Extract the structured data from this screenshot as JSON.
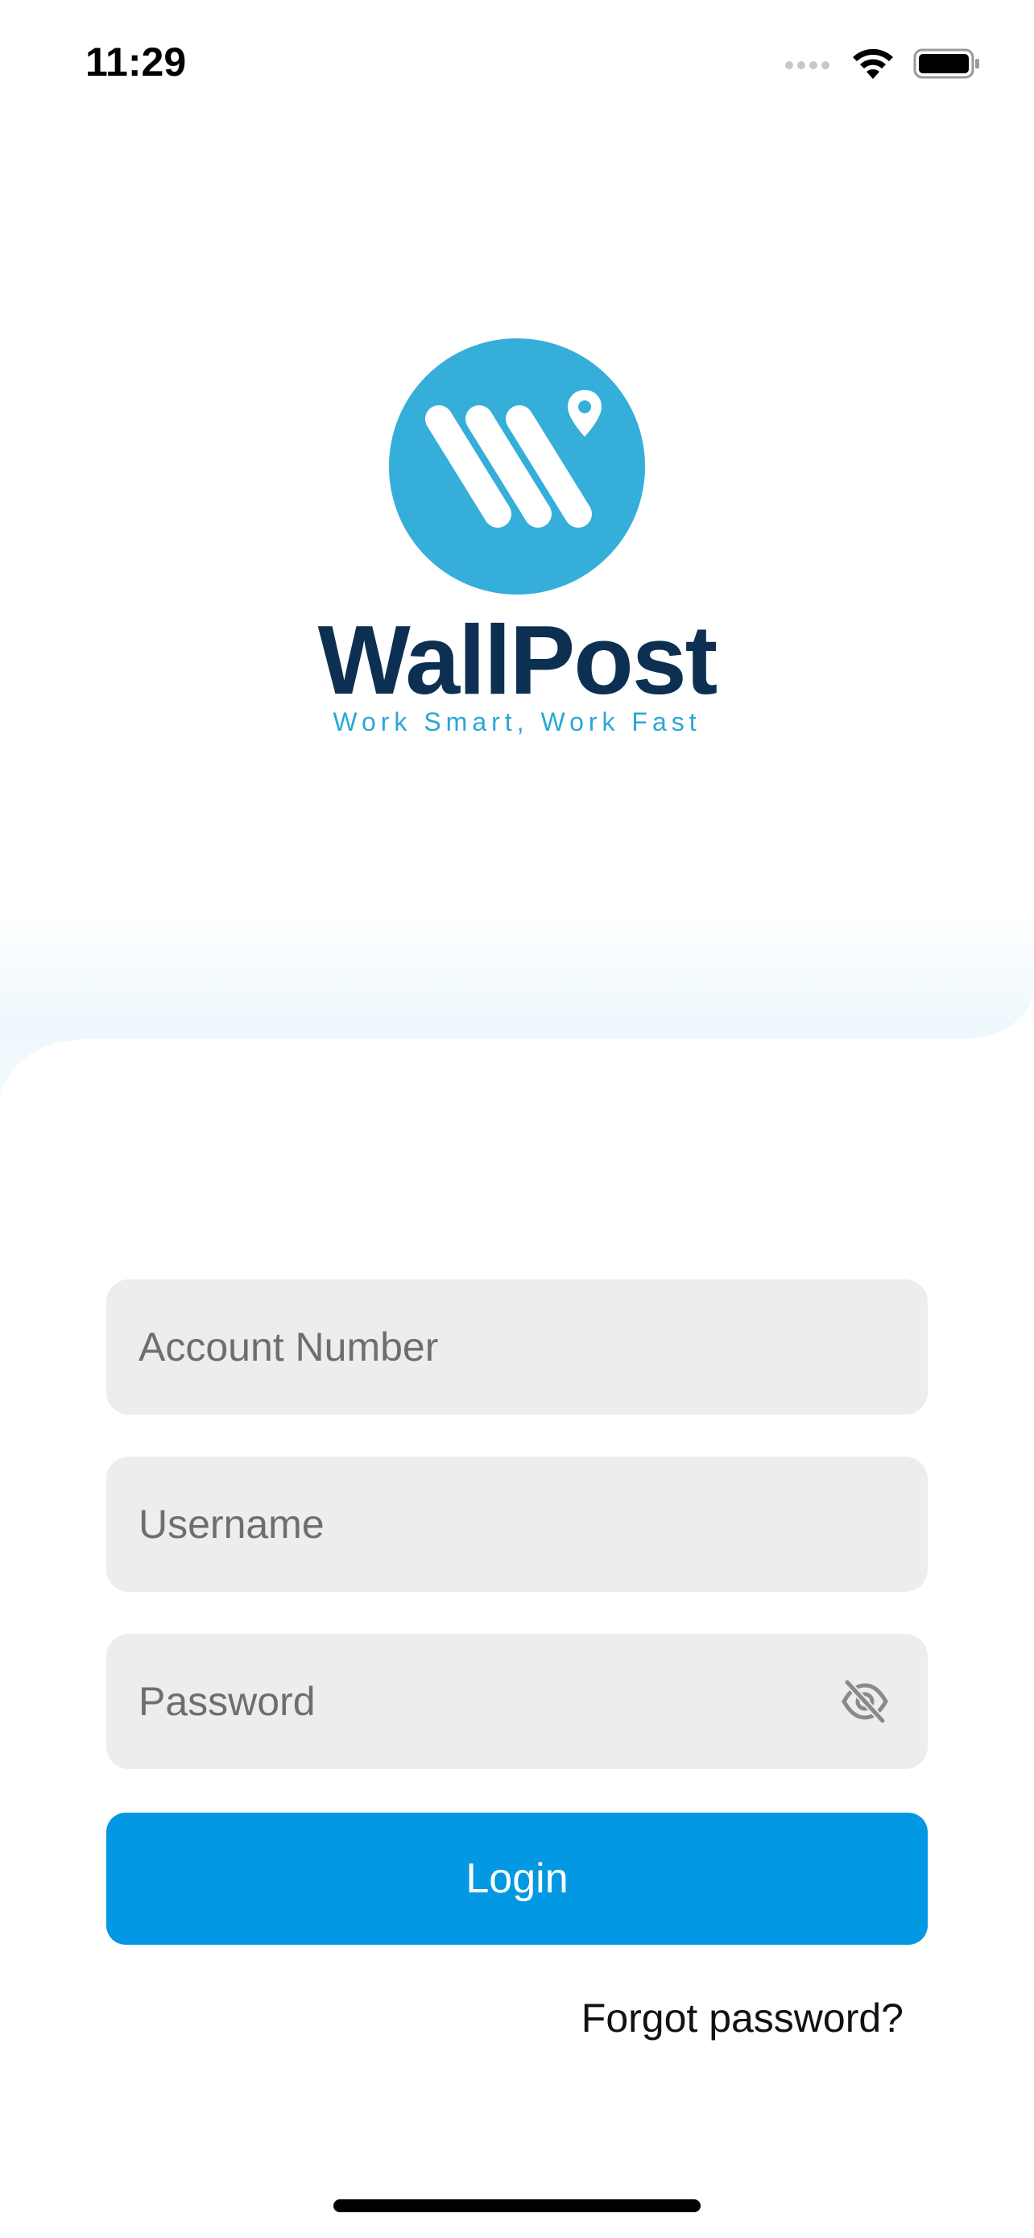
{
  "status_bar": {
    "time": "11:29"
  },
  "brand": {
    "name": "WallPost",
    "tagline": "Work Smart, Work Fast"
  },
  "form": {
    "account_placeholder": "Account Number",
    "account_value": "",
    "username_placeholder": "Username",
    "username_value": "",
    "password_placeholder": "Password",
    "password_value": ""
  },
  "actions": {
    "login_label": "Login",
    "forgot_label": "Forgot password?"
  },
  "icons": {
    "signal": "cellular-signal-icon",
    "wifi": "wifi-icon",
    "battery": "battery-icon",
    "visibility": "eye-off-icon",
    "logo": "wallpost-logo-icon"
  },
  "colors": {
    "primary": "#0398e3",
    "brand_dark": "#0d3052",
    "brand_light": "#35aed9",
    "field_bg": "#ededed"
  }
}
